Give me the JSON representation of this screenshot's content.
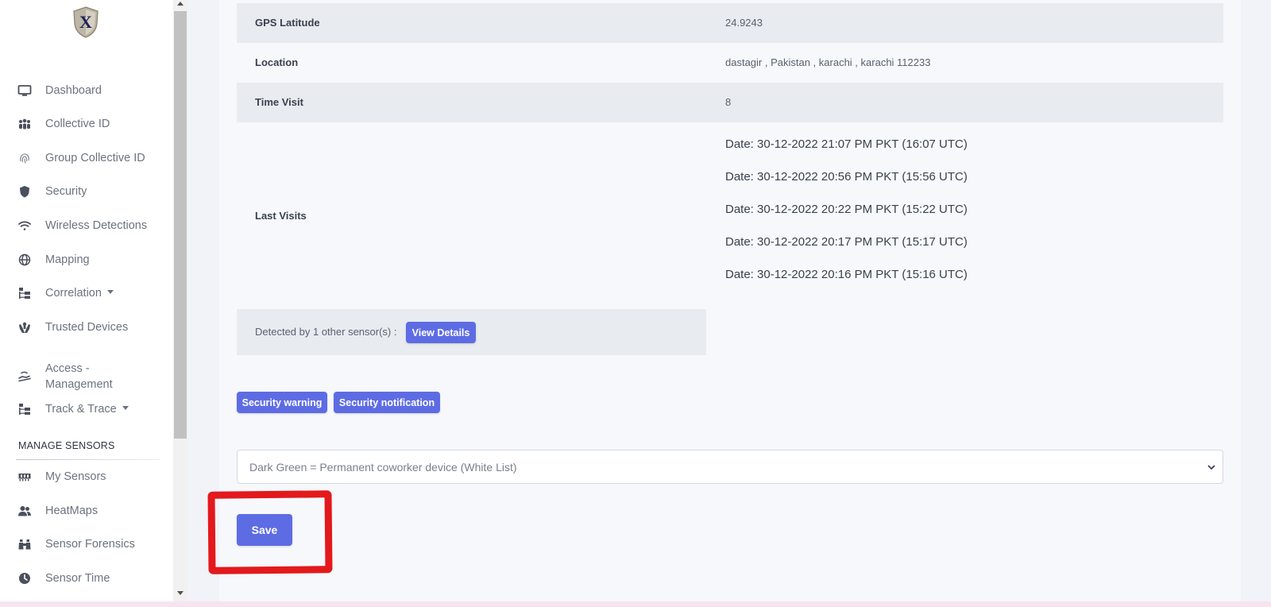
{
  "sidebar": {
    "logo": {
      "letter": "X",
      "icon": "shield-logo-icon"
    },
    "items": [
      {
        "label": "Dashboard",
        "icon": "monitor-icon"
      },
      {
        "label": "Collective ID",
        "icon": "people-group-icon"
      },
      {
        "label": "Group Collective ID",
        "icon": "fingerprint-icon"
      },
      {
        "label": "Security",
        "icon": "shield-icon"
      },
      {
        "label": "Wireless Detections",
        "icon": "wifi-icon"
      },
      {
        "label": "Mapping",
        "icon": "globe-icon"
      },
      {
        "label": "Correlation",
        "icon": "sitemap-icon",
        "dropdown": true
      },
      {
        "label": "Trusted Devices",
        "icon": "hands-helping-icon"
      },
      {
        "label": "Access - Management",
        "icon": "hand-holding-icon"
      },
      {
        "label": "Track & Trace",
        "icon": "sitemap-icon",
        "dropdown": true
      }
    ],
    "section_title": "MANAGE SENSORS",
    "sensor_items": [
      {
        "label": "My Sensors",
        "icon": "memory-icon"
      },
      {
        "label": "HeatMaps",
        "icon": "users-icon"
      },
      {
        "label": "Sensor Forensics",
        "icon": "binoculars-icon"
      },
      {
        "label": "Sensor Time",
        "icon": "clock-icon"
      }
    ]
  },
  "details": {
    "gps_latitude": {
      "label": "GPS Latitude",
      "value": "24.9243"
    },
    "location": {
      "label": "Location",
      "value": "dastagir , Pakistan , karachi , karachi 112233"
    },
    "time_visit": {
      "label": "Time Visit",
      "value": "8"
    },
    "last_visits": {
      "label": "Last Visits",
      "entries": [
        "Date: 30-12-2022 21:07 PM PKT (16:07 UTC)",
        "Date: 30-12-2022 20:56 PM PKT (15:56 UTC)",
        "Date: 30-12-2022 20:22 PM PKT (15:22 UTC)",
        "Date: 30-12-2022 20:17 PM PKT (15:17 UTC)",
        "Date: 30-12-2022 20:16 PM PKT (15:16 UTC)"
      ]
    }
  },
  "detected": {
    "text": "Detected by 1 other sensor(s) :",
    "button": "View Details"
  },
  "alerts": {
    "warning_button": "Security warning",
    "notification_button": "Security notification"
  },
  "device_category": {
    "selected": "Dark Green = Permanent coworker device (White List)"
  },
  "save_button": "Save",
  "colors": {
    "accent": "#5e6ce4",
    "highlight": "#e3191c"
  }
}
